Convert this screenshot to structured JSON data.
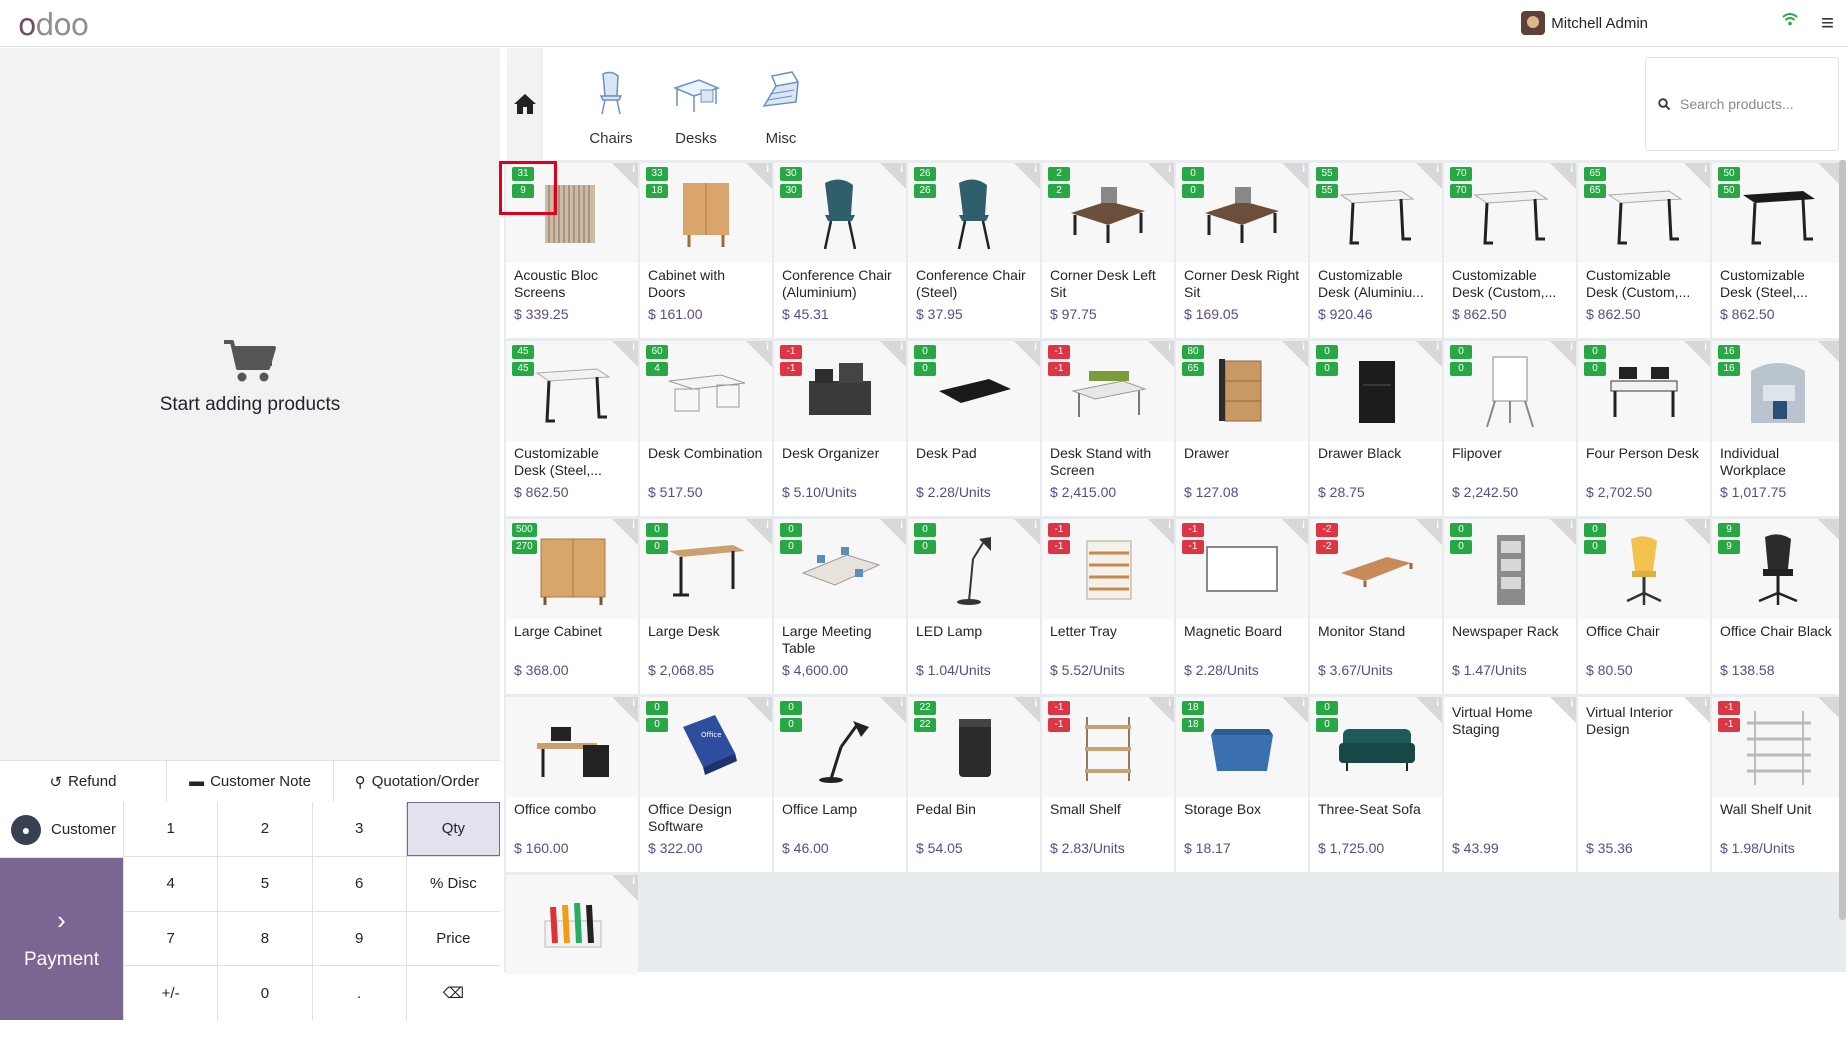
{
  "header": {
    "user_name": "Mitchell Admin"
  },
  "order": {
    "empty_text": "Start adding products",
    "actions": [
      {
        "label": "Refund",
        "icon": "undo-icon"
      },
      {
        "label": "Customer Note",
        "icon": "note-icon"
      },
      {
        "label": "Quotation/Order",
        "icon": "link-icon"
      }
    ],
    "customer_label": "Customer",
    "payment_label": "Payment",
    "keys": [
      "1",
      "2",
      "3",
      "Qty",
      "4",
      "5",
      "6",
      "% Disc",
      "7",
      "8",
      "9",
      "Price",
      "+/-",
      "0",
      ".",
      "⌫"
    ],
    "active_key": "Qty"
  },
  "categories": [
    {
      "label": "Chairs"
    },
    {
      "label": "Desks"
    },
    {
      "label": "Misc"
    }
  ],
  "search": {
    "placeholder": "Search products..."
  },
  "products": [
    {
      "name": "Acoustic Bloc Screens",
      "price": "$ 339.25",
      "b1": "31",
      "b2": "9",
      "neg": false,
      "icon": "screen"
    },
    {
      "name": "Cabinet with Doors",
      "price": "$ 161.00",
      "b1": "33",
      "b2": "18",
      "neg": false,
      "icon": "cabinet"
    },
    {
      "name": "Conference Chair (Aluminium)",
      "price": "$ 45.31",
      "b1": "30",
      "b2": "30",
      "neg": false,
      "icon": "chair-teal"
    },
    {
      "name": "Conference Chair (Steel)",
      "price": "$ 37.95",
      "b1": "26",
      "b2": "26",
      "neg": false,
      "icon": "chair-teal"
    },
    {
      "name": "Corner Desk Left Sit",
      "price": "$ 97.75",
      "b1": "2",
      "b2": "2",
      "neg": false,
      "icon": "desk-dark"
    },
    {
      "name": "Corner Desk Right Sit",
      "price": "$ 169.05",
      "b1": "0",
      "b2": "0",
      "neg": false,
      "icon": "desk-dark"
    },
    {
      "name": "Customizable Desk (Aluminiu...",
      "price": "$ 920.46",
      "b1": "55",
      "b2": "55",
      "neg": false,
      "icon": "table-white"
    },
    {
      "name": "Customizable Desk (Custom,...",
      "price": "$ 862.50",
      "b1": "70",
      "b2": "70",
      "neg": false,
      "icon": "table-white"
    },
    {
      "name": "Customizable Desk (Custom,...",
      "price": "$ 862.50",
      "b1": "65",
      "b2": "65",
      "neg": false,
      "icon": "table-white"
    },
    {
      "name": "Customizable Desk (Steel,...",
      "price": "$ 862.50",
      "b1": "50",
      "b2": "50",
      "neg": false,
      "icon": "table-black"
    },
    {
      "name": "Customizable Desk (Steel,...",
      "price": "$ 862.50",
      "b1": "45",
      "b2": "45",
      "neg": false,
      "icon": "table-white"
    },
    {
      "name": "Desk Combination",
      "price": "$ 517.50",
      "b1": "60",
      "b2": "4",
      "neg": false,
      "icon": "desk-combo"
    },
    {
      "name": "Desk Organizer",
      "price": "$ 5.10/Units",
      "b1": "-1",
      "b2": "-1",
      "neg": true,
      "icon": "organizer"
    },
    {
      "name": "Desk Pad",
      "price": "$ 2.28/Units",
      "b1": "0",
      "b2": "0",
      "neg": false,
      "icon": "pad"
    },
    {
      "name": "Desk Stand with Screen",
      "price": "$ 2,415.00",
      "b1": "-1",
      "b2": "-1",
      "neg": true,
      "icon": "desk-stand"
    },
    {
      "name": "Drawer",
      "price": "$ 127.08",
      "b1": "80",
      "b2": "65",
      "neg": false,
      "icon": "drawer"
    },
    {
      "name": "Drawer Black",
      "price": "$ 28.75",
      "b1": "0",
      "b2": "0",
      "neg": false,
      "icon": "drawer-black"
    },
    {
      "name": "Flipover",
      "price": "$ 2,242.50",
      "b1": "0",
      "b2": "0",
      "neg": false,
      "icon": "flipover"
    },
    {
      "name": "Four Person Desk",
      "price": "$ 2,702.50",
      "b1": "0",
      "b2": "0",
      "neg": false,
      "icon": "four-desk"
    },
    {
      "name": "Individual Workplace",
      "price": "$ 1,017.75",
      "b1": "16",
      "b2": "16",
      "neg": false,
      "icon": "workplace"
    },
    {
      "name": "Large Cabinet",
      "price": "$ 368.00",
      "b1": "500",
      "b2": "270",
      "neg": false,
      "icon": "large-cabinet"
    },
    {
      "name": "Large Desk",
      "price": "$ 2,068.85",
      "b1": "0",
      "b2": "0",
      "neg": false,
      "icon": "large-desk"
    },
    {
      "name": "Large Meeting Table",
      "price": "$ 4,600.00",
      "b1": "0",
      "b2": "0",
      "neg": false,
      "icon": "meeting"
    },
    {
      "name": "LED Lamp",
      "price": "$ 1.04/Units",
      "b1": "0",
      "b2": "0",
      "neg": false,
      "icon": "lamp"
    },
    {
      "name": "Letter Tray",
      "price": "$ 5.52/Units",
      "b1": "-1",
      "b2": "-1",
      "neg": true,
      "icon": "tray"
    },
    {
      "name": "Magnetic Board",
      "price": "$ 2.28/Units",
      "b1": "-1",
      "b2": "-1",
      "neg": true,
      "icon": "board"
    },
    {
      "name": "Monitor Stand",
      "price": "$ 3.67/Units",
      "b1": "-2",
      "b2": "-2",
      "neg": true,
      "icon": "monitor-stand"
    },
    {
      "name": "Newspaper Rack",
      "price": "$ 1.47/Units",
      "b1": "0",
      "b2": "0",
      "neg": false,
      "icon": "rack"
    },
    {
      "name": "Office Chair",
      "price": "$ 80.50",
      "b1": "0",
      "b2": "0",
      "neg": false,
      "icon": "chair-yellow"
    },
    {
      "name": "Office Chair Black",
      "price": "$ 138.58",
      "b1": "9",
      "b2": "9",
      "neg": false,
      "icon": "chair-black"
    },
    {
      "name": "Office combo",
      "price": "$ 160.00",
      "b1": "",
      "b2": "",
      "neg": false,
      "icon": "office-combo"
    },
    {
      "name": "Office Design Software",
      "price": "$ 322.00",
      "b1": "0",
      "b2": "0",
      "neg": false,
      "icon": "software"
    },
    {
      "name": "Office Lamp",
      "price": "$ 46.00",
      "b1": "0",
      "b2": "0",
      "neg": false,
      "icon": "office-lamp"
    },
    {
      "name": "Pedal Bin",
      "price": "$ 54.05",
      "b1": "22",
      "b2": "22",
      "neg": false,
      "icon": "bin"
    },
    {
      "name": "Small Shelf",
      "price": "$ 2.83/Units",
      "b1": "-1",
      "b2": "-1",
      "neg": true,
      "icon": "shelf"
    },
    {
      "name": "Storage Box",
      "price": "$ 18.17",
      "b1": "18",
      "b2": "18",
      "neg": false,
      "icon": "box"
    },
    {
      "name": "Three-Seat Sofa",
      "price": "$ 1,725.00",
      "b1": "0",
      "b2": "0",
      "neg": false,
      "icon": "sofa"
    },
    {
      "name": "Virtual Home Staging",
      "price": "$ 43.99",
      "b1": "",
      "b2": "",
      "neg": false,
      "icon": "",
      "noimg": true
    },
    {
      "name": "Virtual Interior Design",
      "price": "$ 35.36",
      "b1": "",
      "b2": "",
      "neg": false,
      "icon": "",
      "noimg": true
    },
    {
      "name": "Wall Shelf Unit",
      "price": "$ 1.98/Units",
      "b1": "-1",
      "b2": "-1",
      "neg": true,
      "icon": "wall-shelf"
    },
    {
      "name": "",
      "price": "",
      "b1": "",
      "b2": "",
      "neg": false,
      "icon": "markers"
    }
  ],
  "colors": {
    "accent": "#7b6593",
    "price": "#5b4a8a",
    "badge_pos": "#28a745",
    "badge_neg": "#dc3545"
  }
}
